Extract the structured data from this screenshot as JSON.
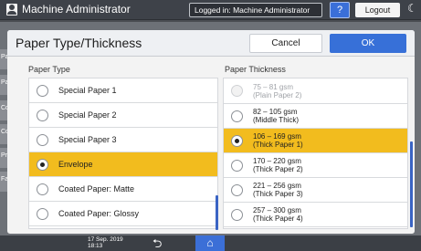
{
  "topbar": {
    "title": "Machine Administrator",
    "login_status": "Logged in: Machine Administrator",
    "help_label": "?",
    "logout_label": "Logout",
    "moon_glyph": "☾"
  },
  "background_tabs": [
    "Pap",
    "Pap",
    "Con",
    "Cop",
    "Prin",
    "Fax"
  ],
  "dialog": {
    "title": "Paper Type/Thickness",
    "cancel_label": "Cancel",
    "ok_label": "OK",
    "paper_type": {
      "heading": "Paper Type",
      "items": [
        {
          "label": "Special Paper 1",
          "selected": false
        },
        {
          "label": "Special Paper 2",
          "selected": false
        },
        {
          "label": "Special Paper 3",
          "selected": false
        },
        {
          "label": "Envelope",
          "selected": true
        },
        {
          "label": "Coated Paper: Matte",
          "selected": false
        },
        {
          "label": "Coated Paper: Glossy",
          "selected": false
        }
      ]
    },
    "paper_thickness": {
      "heading": "Paper Thickness",
      "items": [
        {
          "line1": "75 – 81 gsm",
          "line2": "(Plain Paper 2)",
          "selected": false,
          "disabled": true
        },
        {
          "line1": "82 – 105 gsm",
          "line2": "(Middle Thick)",
          "selected": false,
          "disabled": false
        },
        {
          "line1": "106 – 169 gsm",
          "line2": "(Thick Paper 1)",
          "selected": true,
          "disabled": false
        },
        {
          "line1": "170 – 220 gsm",
          "line2": "(Thick Paper 2)",
          "selected": false,
          "disabled": false
        },
        {
          "line1": "221 – 256 gsm",
          "line2": "(Thick Paper 3)",
          "selected": false,
          "disabled": false
        },
        {
          "line1": "257 – 300 gsm",
          "line2": "(Thick Paper 4)",
          "selected": false,
          "disabled": false
        }
      ]
    }
  },
  "bottombar": {
    "date": "17 Sep. 2019",
    "time": "18:13"
  },
  "colors": {
    "accent": "#3770d8",
    "selected_row": "#f2bc1e"
  }
}
